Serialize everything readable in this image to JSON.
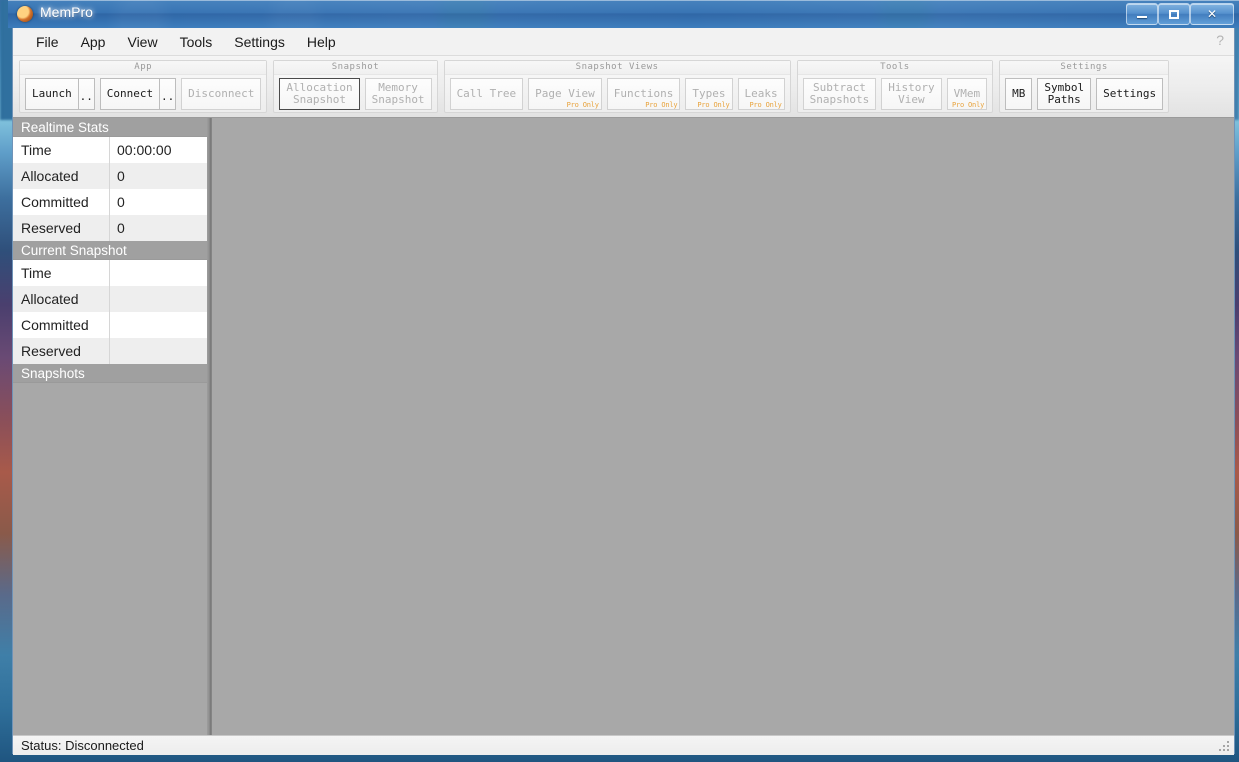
{
  "window": {
    "title": "MemPro",
    "icon": "app-icon",
    "controls": {
      "minimize": "minimize-icon",
      "maximize": "maximize-icon",
      "close": "✕"
    }
  },
  "menu": {
    "items": [
      {
        "label": "File"
      },
      {
        "label": "App"
      },
      {
        "label": "View"
      },
      {
        "label": "Tools"
      },
      {
        "label": "Settings"
      },
      {
        "label": "Help"
      }
    ],
    "help_icon": "?"
  },
  "toolbar": {
    "groups": [
      {
        "title": "App",
        "buttons": [
          {
            "label": "Launch",
            "disabled": false,
            "pro": false,
            "focused": false,
            "split": true,
            "split_label": ".."
          },
          {
            "label": "Connect",
            "disabled": false,
            "pro": false,
            "focused": false,
            "split": true,
            "split_label": ".."
          },
          {
            "label": "Disconnect",
            "disabled": true,
            "pro": false,
            "focused": false,
            "split": false
          }
        ]
      },
      {
        "title": "Snapshot",
        "buttons": [
          {
            "label": "Allocation\nSnapshot",
            "disabled": true,
            "pro": false,
            "focused": true,
            "split": false
          },
          {
            "label": "Memory\nSnapshot",
            "disabled": true,
            "pro": false,
            "focused": false,
            "split": false
          }
        ]
      },
      {
        "title": "Snapshot Views",
        "buttons": [
          {
            "label": "Call Tree",
            "disabled": true,
            "pro": false,
            "focused": false,
            "split": false
          },
          {
            "label": "Page View",
            "disabled": true,
            "pro": true,
            "focused": false,
            "split": false
          },
          {
            "label": "Functions",
            "disabled": true,
            "pro": true,
            "focused": false,
            "split": false
          },
          {
            "label": "Types",
            "disabled": true,
            "pro": true,
            "focused": false,
            "split": false
          },
          {
            "label": "Leaks",
            "disabled": true,
            "pro": true,
            "focused": false,
            "split": false
          }
        ]
      },
      {
        "title": "Tools",
        "buttons": [
          {
            "label": "Subtract\nSnapshots",
            "disabled": true,
            "pro": false,
            "focused": false,
            "split": false
          },
          {
            "label": "History\nView",
            "disabled": true,
            "pro": false,
            "focused": false,
            "split": false
          },
          {
            "label": "VMem",
            "disabled": true,
            "pro": true,
            "focused": false,
            "split": false
          }
        ]
      },
      {
        "title": "Settings",
        "buttons": [
          {
            "label": "MB",
            "disabled": false,
            "pro": false,
            "focused": false,
            "split": false
          },
          {
            "label": "Symbol\nPaths",
            "disabled": false,
            "pro": false,
            "focused": false,
            "split": false
          },
          {
            "label": "Settings",
            "disabled": false,
            "pro": false,
            "focused": false,
            "split": false
          }
        ]
      }
    ],
    "pro_badge_label": "Pro Only",
    "pro_badge_color": "#e8a33d"
  },
  "sidebar": {
    "sections": [
      {
        "header": "Realtime Stats",
        "rows": [
          {
            "label": "Time",
            "value": "00:00:00"
          },
          {
            "label": "Allocated",
            "value": "0"
          },
          {
            "label": "Committed",
            "value": "0"
          },
          {
            "label": "Reserved",
            "value": "0"
          }
        ]
      },
      {
        "header": "Current Snapshot",
        "rows": [
          {
            "label": "Time",
            "value": ""
          },
          {
            "label": "Allocated",
            "value": ""
          },
          {
            "label": "Committed",
            "value": ""
          },
          {
            "label": "Reserved",
            "value": ""
          }
        ]
      },
      {
        "header": "Snapshots",
        "rows": []
      }
    ]
  },
  "status_bar": {
    "text": "Status: Disconnected",
    "grip": "resize-grip"
  }
}
